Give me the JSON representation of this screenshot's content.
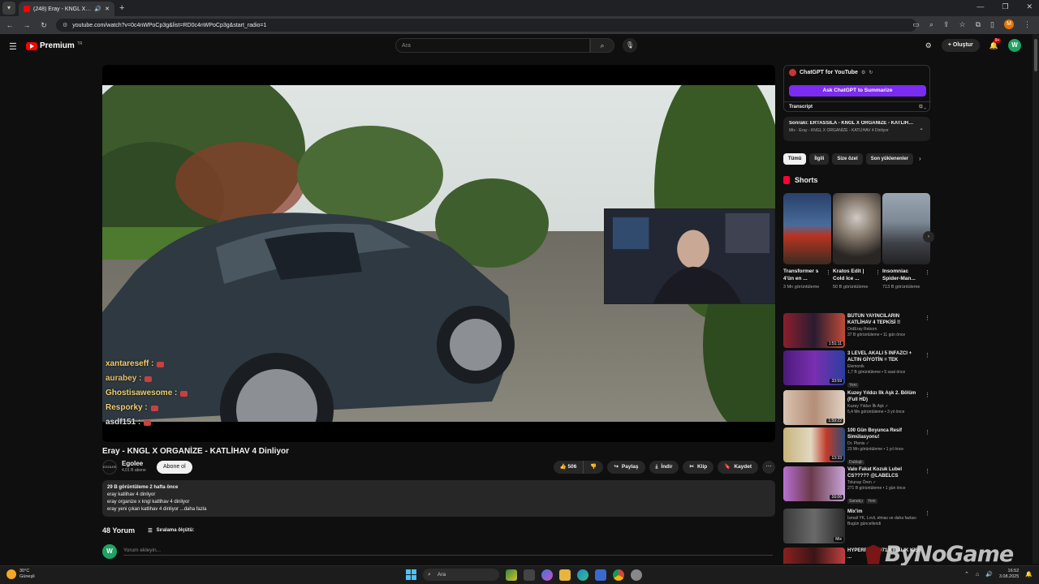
{
  "browser": {
    "tab_title": "(248) Eray - KNGL X ORGA...",
    "url": "youtube.com/watch?v=0c4nWPoCp3g&list=RD0c4nWPoCp3g&start_radio=1"
  },
  "header": {
    "logo_text": "Premium",
    "logo_region": "TR",
    "search_placeholder": "Ara",
    "create_label": "Oluştur",
    "notif_count": "9+",
    "user_initial": "W",
    "browser_user_initial": "M"
  },
  "player": {
    "chat": [
      {
        "name": "xantareseff :"
      },
      {
        "name": "aurabey :"
      },
      {
        "name": "Ghostisawesome :"
      },
      {
        "name": "Resporky :"
      },
      {
        "name": "asdf151 :"
      }
    ]
  },
  "video": {
    "title": "Eray - KNGL X ORGANİZE - KATLİHAV 4 Dinliyor",
    "channel_name": "Egolee",
    "channel_subs": "4,01 B abone",
    "channel_avatar_text": "EGOLEE",
    "subscribe_label": "Abone ol",
    "likes": "506",
    "share_label": "Paylaş",
    "download_label": "İndir",
    "clip_label": "Klip",
    "save_label": "Kaydet",
    "desc_meta": "29 B görüntüleme  2 hafta önce",
    "desc_lines": [
      "eray katlihav 4 dinliyor",
      "eray organize x kngl katlihav 4 dinliyor",
      "eray yeni çıkan katlihav  4 dinliyor ...daha fazla"
    ]
  },
  "comments": {
    "count_label": "48 Yorum",
    "sort_label": "Sıralama ölçütü:",
    "add_placeholder": "Yorum ekleyin..."
  },
  "gpt_panel": {
    "title": "ChatGPT for YouTube",
    "button_label": "Ask ChatGPT to Summarize",
    "transcript_label": "Transcript"
  },
  "next_up": {
    "title": "Sonraki: ERTASSILA - KNGL X ORGANİZE - KATLİHA...",
    "sub": "Mix - Eray - KNGL X ORGANİZE - KATLİHAV 4 Dinliyor"
  },
  "chips": [
    "Tümü",
    "İlgili",
    "Size özel",
    "Son yüklenenler"
  ],
  "shorts": {
    "header": "Shorts",
    "items": [
      {
        "title": "Transformer s 4'ün en ...",
        "views": "3 Mn görüntüleme"
      },
      {
        "title": "Kratos Edit | Cold Ice ...",
        "views": "50 B görüntüleme"
      },
      {
        "title": "Insomniac Spider-Man...",
        "views": "713 B görüntüleme"
      }
    ]
  },
  "recommendations": [
    {
      "title": "BÜTÜN YAYINCILARIN KATLİHAV 4 TEPKİSİ !!",
      "channel": "OrdEray Reborn",
      "meta": "37 B görüntüleme • 11 gün önce",
      "duration": "1:51:11",
      "tags": []
    },
    {
      "title": "3 LEVEL AKALI 5 İNFAZCI + ALTIN GİYOTİN = TEK VURUŞT...",
      "channel": "Elemonik",
      "meta": "1,7 B görüntüleme • 5 saat önce",
      "duration": "33:59",
      "tags": [
        "Yeni"
      ]
    },
    {
      "title": "Kuzey Yıldızı İlk Aşk 2. Bölüm (Full HD)",
      "channel": "Kuzey Yıldızı İlk Aşk ✓",
      "meta": "5,4 Mn görüntüleme • 3 yıl önce",
      "duration": "1:59:22",
      "tags": []
    },
    {
      "title": "100 Gün Boyunca Resif Simülasyonu!",
      "channel": "Dr. Plenis ✓",
      "meta": "23 Mn görüntüleme • 1 yıl önce",
      "duration": "13:33",
      "tags": [
        "Dublajlı"
      ]
    },
    {
      "title": "Valo Fakat Kozuk Lubel CS????? @LABELCS @overdosevl",
      "channel": "Tolunay Ören ✓",
      "meta": "271 B görüntüleme • 1 gün önce",
      "duration": "16:06",
      "tags": [
        "Sanatçı",
        "Yeni"
      ]
    },
    {
      "title": "Mix'im",
      "channel": "İsmail YK, Lvvli, elmas ve daha fazlası",
      "meta": "Bugün güncellendi",
      "duration": "Mix",
      "tags": []
    },
    {
      "title": "HYPERROUT #71 KİRALIK KİŞİ ...",
      "channel": "",
      "meta": "",
      "duration": "",
      "tags": []
    }
  ],
  "watermark": "ByNoGame",
  "taskbar": {
    "temp": "30°C",
    "weather": "Güneşli",
    "search": "Ara",
    "time": "16:52",
    "date": "3.08.2025"
  }
}
